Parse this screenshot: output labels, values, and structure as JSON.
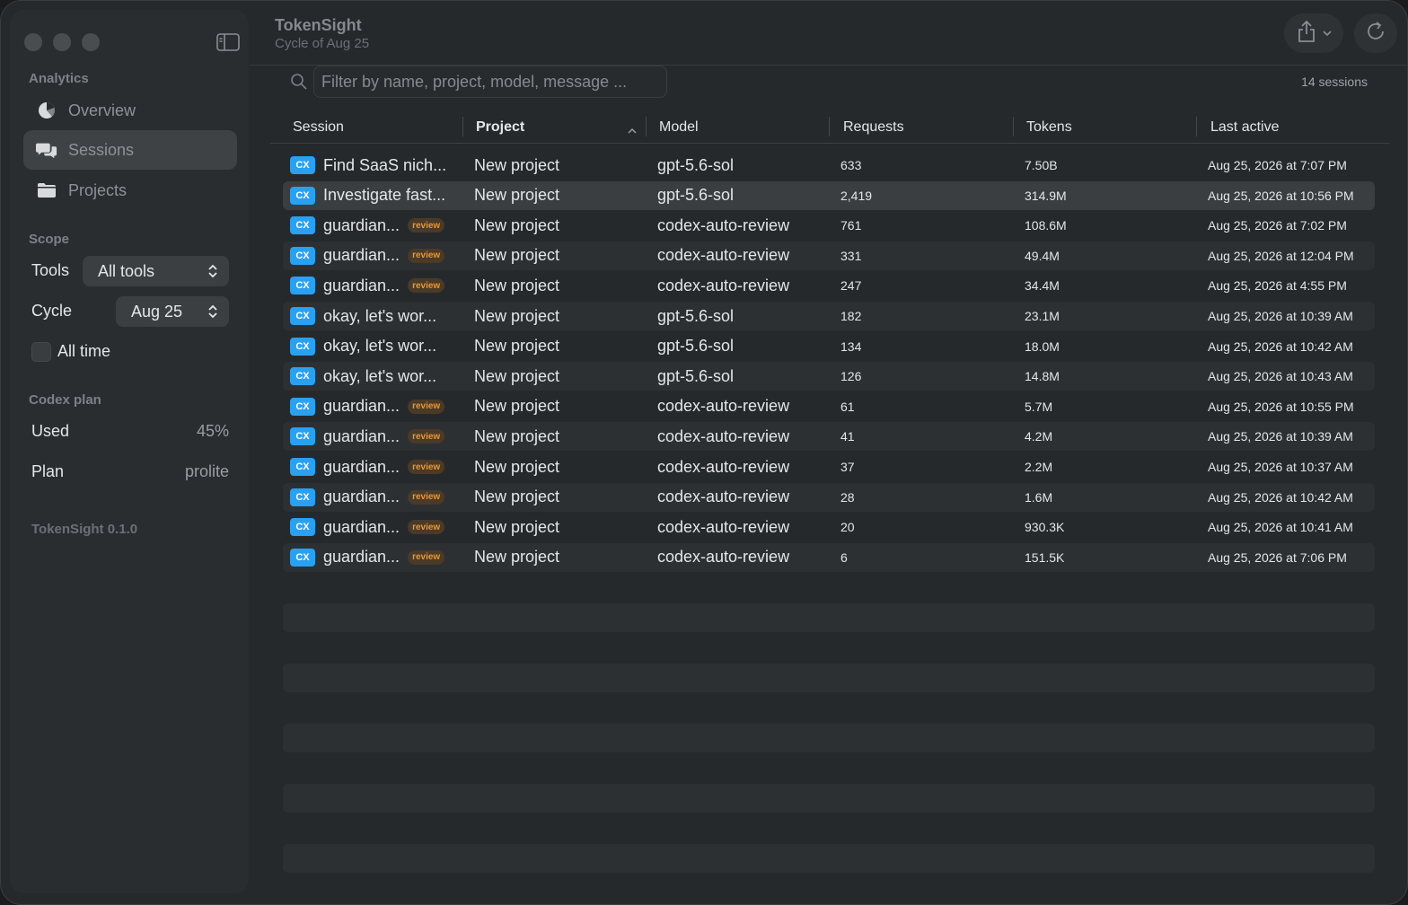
{
  "app": {
    "title": "TokenSight",
    "subtitle": "Cycle of Aug 25",
    "version": "TokenSight 0.1.0"
  },
  "sidebar": {
    "analytics_label": "Analytics",
    "nav": [
      {
        "label": "Overview",
        "icon": "pie-chart-icon"
      },
      {
        "label": "Sessions",
        "icon": "chat-bubbles-icon",
        "active": true
      },
      {
        "label": "Projects",
        "icon": "folder-icon"
      }
    ],
    "scope_label": "Scope",
    "tools_label": "Tools",
    "tools_value": "All tools",
    "cycle_label": "Cycle",
    "cycle_value": "Aug 25",
    "all_time_label": "All time",
    "plan_section_label": "Codex plan",
    "used_label": "Used",
    "used_value": "45%",
    "plan_label": "Plan",
    "plan_value": "prolite"
  },
  "toolbar": {
    "share_icon": "share-icon",
    "refresh_icon": "refresh-icon"
  },
  "search": {
    "placeholder": "Filter by name, project, model, message ..."
  },
  "session_count": "14 sessions",
  "table": {
    "columns": [
      "Session",
      "Project",
      "Model",
      "Requests",
      "Tokens",
      "Last active"
    ],
    "sorted_column": "Project",
    "badge_label": "CX",
    "review_label": "review",
    "rows": [
      {
        "session": "Find SaaS nich...",
        "review": false,
        "project": "New project",
        "model": "gpt-5.6-sol",
        "requests": "633",
        "tokens": "7.50B",
        "last_active": "Aug 25, 2026 at 7:07 PM"
      },
      {
        "session": "Investigate fast...",
        "review": false,
        "project": "New project",
        "model": "gpt-5.6-sol",
        "requests": "2,419",
        "tokens": "314.9M",
        "last_active": "Aug 25, 2026 at 10:56 PM",
        "selected": true
      },
      {
        "session": "guardian...",
        "review": true,
        "project": "New project",
        "model": "codex-auto-review",
        "requests": "761",
        "tokens": "108.6M",
        "last_active": "Aug 25, 2026 at 7:02 PM"
      },
      {
        "session": "guardian...",
        "review": true,
        "project": "New project",
        "model": "codex-auto-review",
        "requests": "331",
        "tokens": "49.4M",
        "last_active": "Aug 25, 2026 at 12:04 PM"
      },
      {
        "session": "guardian...",
        "review": true,
        "project": "New project",
        "model": "codex-auto-review",
        "requests": "247",
        "tokens": "34.4M",
        "last_active": "Aug 25, 2026 at 4:55 PM"
      },
      {
        "session": "okay, let's wor...",
        "review": false,
        "project": "New project",
        "model": "gpt-5.6-sol",
        "requests": "182",
        "tokens": "23.1M",
        "last_active": "Aug 25, 2026 at 10:39 AM"
      },
      {
        "session": "okay, let's wor...",
        "review": false,
        "project": "New project",
        "model": "gpt-5.6-sol",
        "requests": "134",
        "tokens": "18.0M",
        "last_active": "Aug 25, 2026 at 10:42 AM"
      },
      {
        "session": "okay, let's wor...",
        "review": false,
        "project": "New project",
        "model": "gpt-5.6-sol",
        "requests": "126",
        "tokens": "14.8M",
        "last_active": "Aug 25, 2026 at 10:43 AM"
      },
      {
        "session": "guardian...",
        "review": true,
        "project": "New project",
        "model": "codex-auto-review",
        "requests": "61",
        "tokens": "5.7M",
        "last_active": "Aug 25, 2026 at 10:55 PM"
      },
      {
        "session": "guardian...",
        "review": true,
        "project": "New project",
        "model": "codex-auto-review",
        "requests": "41",
        "tokens": "4.2M",
        "last_active": "Aug 25, 2026 at 10:39 AM"
      },
      {
        "session": "guardian...",
        "review": true,
        "project": "New project",
        "model": "codex-auto-review",
        "requests": "37",
        "tokens": "2.2M",
        "last_active": "Aug 25, 2026 at 10:37 AM"
      },
      {
        "session": "guardian...",
        "review": true,
        "project": "New project",
        "model": "codex-auto-review",
        "requests": "28",
        "tokens": "1.6M",
        "last_active": "Aug 25, 2026 at 10:42 AM"
      },
      {
        "session": "guardian...",
        "review": true,
        "project": "New project",
        "model": "codex-auto-review",
        "requests": "20",
        "tokens": "930.3K",
        "last_active": "Aug 25, 2026 at 10:41 AM"
      },
      {
        "session": "guardian...",
        "review": true,
        "project": "New project",
        "model": "codex-auto-review",
        "requests": "6",
        "tokens": "151.5K",
        "last_active": "Aug 25, 2026 at 7:06 PM"
      }
    ]
  },
  "colors": {
    "badge": "#2aa0f0",
    "review_text": "#e8973c",
    "window_bg": "#26292c",
    "sidebar_bg": "#2a2d30",
    "selected_row": "#3b3e41"
  }
}
